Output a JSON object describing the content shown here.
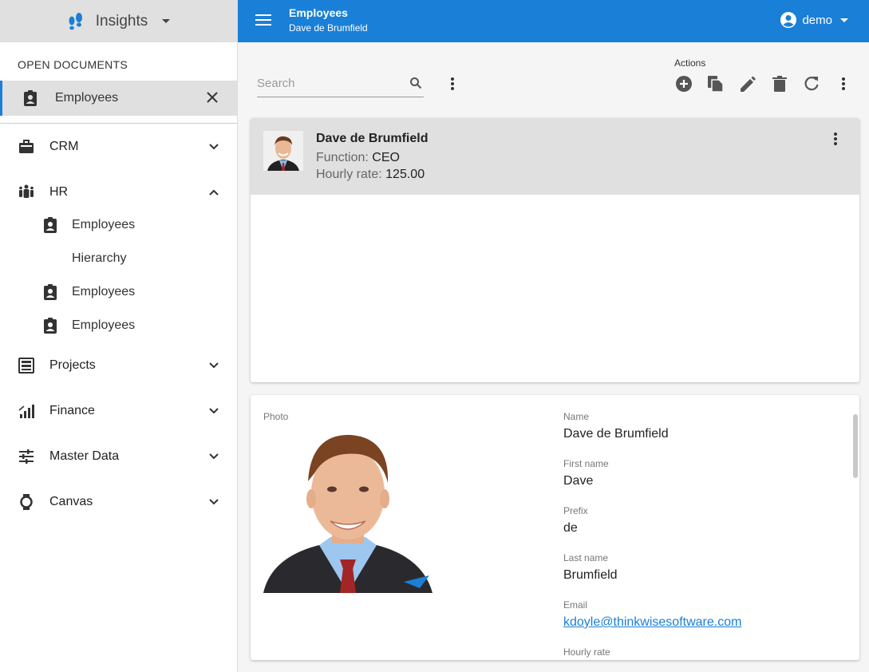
{
  "app": {
    "name": "Insights"
  },
  "sidebar": {
    "open_documents_label": "OPEN DOCUMENTS",
    "open_doc": {
      "label": "Employees"
    },
    "items": [
      {
        "label": "CRM",
        "icon": "briefcase-icon"
      },
      {
        "label": "HR",
        "icon": "people-icon",
        "expanded": true
      },
      {
        "label": "Projects",
        "icon": "filing-cabinet-icon"
      },
      {
        "label": "Finance",
        "icon": "bar-chart-icon"
      },
      {
        "label": "Master Data",
        "icon": "sliders-icon"
      },
      {
        "label": "Canvas",
        "icon": "watch-icon"
      }
    ],
    "hr_sub": [
      "Employees",
      "Hierarchy",
      "Employees",
      "Employees"
    ]
  },
  "topbar": {
    "title": "Employees",
    "subtitle": "Dave de Brumfield",
    "user": "demo",
    "color": "#1a7fd6"
  },
  "toolbar": {
    "search_placeholder": "Search",
    "actions_label": "Actions",
    "actions": [
      "add-icon",
      "copy-icon",
      "edit-icon",
      "delete-icon",
      "refresh-icon",
      "more-icon"
    ]
  },
  "list": {
    "selected": {
      "name": "Dave de Brumfield",
      "function_label": "Function:",
      "function": "CEO",
      "rate_label": "Hourly rate:",
      "rate": "125.00"
    }
  },
  "detail": {
    "photo_label": "Photo",
    "fields": [
      {
        "label": "Name",
        "value": "Dave de Brumfield"
      },
      {
        "label": "First name",
        "value": "Dave"
      },
      {
        "label": "Prefix",
        "value": "de"
      },
      {
        "label": "Last name",
        "value": "Brumfield"
      },
      {
        "label": "Email",
        "value": "kdoyle@thinkwisesoftware.com"
      },
      {
        "label": "Hourly rate",
        "value": ""
      }
    ]
  }
}
